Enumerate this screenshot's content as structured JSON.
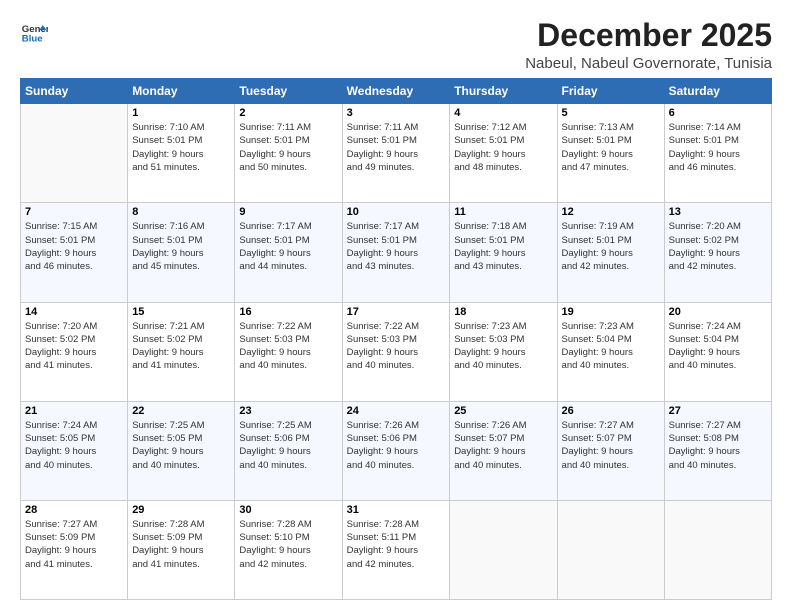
{
  "logo": {
    "line1": "General",
    "line2": "Blue"
  },
  "header": {
    "title": "December 2025",
    "subtitle": "Nabeul, Nabeul Governorate, Tunisia"
  },
  "days_of_week": [
    "Sunday",
    "Monday",
    "Tuesday",
    "Wednesday",
    "Thursday",
    "Friday",
    "Saturday"
  ],
  "weeks": [
    [
      {
        "num": "",
        "info": ""
      },
      {
        "num": "1",
        "info": "Sunrise: 7:10 AM\nSunset: 5:01 PM\nDaylight: 9 hours\nand 51 minutes."
      },
      {
        "num": "2",
        "info": "Sunrise: 7:11 AM\nSunset: 5:01 PM\nDaylight: 9 hours\nand 50 minutes."
      },
      {
        "num": "3",
        "info": "Sunrise: 7:11 AM\nSunset: 5:01 PM\nDaylight: 9 hours\nand 49 minutes."
      },
      {
        "num": "4",
        "info": "Sunrise: 7:12 AM\nSunset: 5:01 PM\nDaylight: 9 hours\nand 48 minutes."
      },
      {
        "num": "5",
        "info": "Sunrise: 7:13 AM\nSunset: 5:01 PM\nDaylight: 9 hours\nand 47 minutes."
      },
      {
        "num": "6",
        "info": "Sunrise: 7:14 AM\nSunset: 5:01 PM\nDaylight: 9 hours\nand 46 minutes."
      }
    ],
    [
      {
        "num": "7",
        "info": "Sunrise: 7:15 AM\nSunset: 5:01 PM\nDaylight: 9 hours\nand 46 minutes."
      },
      {
        "num": "8",
        "info": "Sunrise: 7:16 AM\nSunset: 5:01 PM\nDaylight: 9 hours\nand 45 minutes."
      },
      {
        "num": "9",
        "info": "Sunrise: 7:17 AM\nSunset: 5:01 PM\nDaylight: 9 hours\nand 44 minutes."
      },
      {
        "num": "10",
        "info": "Sunrise: 7:17 AM\nSunset: 5:01 PM\nDaylight: 9 hours\nand 43 minutes."
      },
      {
        "num": "11",
        "info": "Sunrise: 7:18 AM\nSunset: 5:01 PM\nDaylight: 9 hours\nand 43 minutes."
      },
      {
        "num": "12",
        "info": "Sunrise: 7:19 AM\nSunset: 5:01 PM\nDaylight: 9 hours\nand 42 minutes."
      },
      {
        "num": "13",
        "info": "Sunrise: 7:20 AM\nSunset: 5:02 PM\nDaylight: 9 hours\nand 42 minutes."
      }
    ],
    [
      {
        "num": "14",
        "info": "Sunrise: 7:20 AM\nSunset: 5:02 PM\nDaylight: 9 hours\nand 41 minutes."
      },
      {
        "num": "15",
        "info": "Sunrise: 7:21 AM\nSunset: 5:02 PM\nDaylight: 9 hours\nand 41 minutes."
      },
      {
        "num": "16",
        "info": "Sunrise: 7:22 AM\nSunset: 5:03 PM\nDaylight: 9 hours\nand 40 minutes."
      },
      {
        "num": "17",
        "info": "Sunrise: 7:22 AM\nSunset: 5:03 PM\nDaylight: 9 hours\nand 40 minutes."
      },
      {
        "num": "18",
        "info": "Sunrise: 7:23 AM\nSunset: 5:03 PM\nDaylight: 9 hours\nand 40 minutes."
      },
      {
        "num": "19",
        "info": "Sunrise: 7:23 AM\nSunset: 5:04 PM\nDaylight: 9 hours\nand 40 minutes."
      },
      {
        "num": "20",
        "info": "Sunrise: 7:24 AM\nSunset: 5:04 PM\nDaylight: 9 hours\nand 40 minutes."
      }
    ],
    [
      {
        "num": "21",
        "info": "Sunrise: 7:24 AM\nSunset: 5:05 PM\nDaylight: 9 hours\nand 40 minutes."
      },
      {
        "num": "22",
        "info": "Sunrise: 7:25 AM\nSunset: 5:05 PM\nDaylight: 9 hours\nand 40 minutes."
      },
      {
        "num": "23",
        "info": "Sunrise: 7:25 AM\nSunset: 5:06 PM\nDaylight: 9 hours\nand 40 minutes."
      },
      {
        "num": "24",
        "info": "Sunrise: 7:26 AM\nSunset: 5:06 PM\nDaylight: 9 hours\nand 40 minutes."
      },
      {
        "num": "25",
        "info": "Sunrise: 7:26 AM\nSunset: 5:07 PM\nDaylight: 9 hours\nand 40 minutes."
      },
      {
        "num": "26",
        "info": "Sunrise: 7:27 AM\nSunset: 5:07 PM\nDaylight: 9 hours\nand 40 minutes."
      },
      {
        "num": "27",
        "info": "Sunrise: 7:27 AM\nSunset: 5:08 PM\nDaylight: 9 hours\nand 40 minutes."
      }
    ],
    [
      {
        "num": "28",
        "info": "Sunrise: 7:27 AM\nSunset: 5:09 PM\nDaylight: 9 hours\nand 41 minutes."
      },
      {
        "num": "29",
        "info": "Sunrise: 7:28 AM\nSunset: 5:09 PM\nDaylight: 9 hours\nand 41 minutes."
      },
      {
        "num": "30",
        "info": "Sunrise: 7:28 AM\nSunset: 5:10 PM\nDaylight: 9 hours\nand 42 minutes."
      },
      {
        "num": "31",
        "info": "Sunrise: 7:28 AM\nSunset: 5:11 PM\nDaylight: 9 hours\nand 42 minutes."
      },
      {
        "num": "",
        "info": ""
      },
      {
        "num": "",
        "info": ""
      },
      {
        "num": "",
        "info": ""
      }
    ]
  ]
}
